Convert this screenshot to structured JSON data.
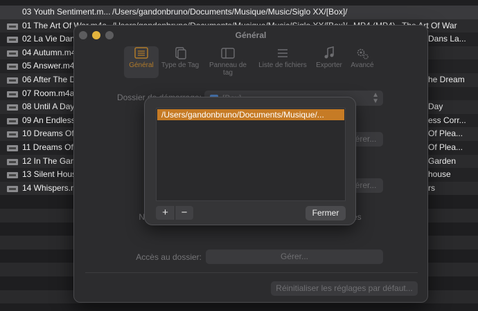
{
  "file_list": {
    "rows": [
      {
        "name": "03 Youth Sentiment.m...",
        "path": "/Users/gandonbruno/Documents/Musique/Music/Siglo XX/[Box]/",
        "format": "",
        "right": ""
      },
      {
        "name": "01 The Art Of War.m4a",
        "path": "/Users/gandonbruno/Documents/Musique/Music/Siglo XX/[Box]/",
        "format": "MP4 (MP4)",
        "right": "The Art Of War"
      },
      {
        "name": "02 La Vie Dan",
        "path": "",
        "format": "",
        "right": "Dans La..."
      },
      {
        "name": "04 Autumn.m4",
        "path": "",
        "format": "",
        "right": ""
      },
      {
        "name": "05 Answer.m4",
        "path": "",
        "format": "",
        "right": ""
      },
      {
        "name": "06 After The D",
        "path": "",
        "format": "",
        "right": "he Dream"
      },
      {
        "name": "07 Room.m4a",
        "path": "",
        "format": "",
        "right": ""
      },
      {
        "name": "08 Until A Day",
        "path": "",
        "format": "",
        "right": "Day"
      },
      {
        "name": "09 An Endless",
        "path": "",
        "format": "",
        "right": "ess Corr..."
      },
      {
        "name": "10 Dreams Of",
        "path": "",
        "format": "",
        "right": "Of Plea..."
      },
      {
        "name": "11 Dreams Of",
        "path": "",
        "format": "",
        "right": "Of Plea..."
      },
      {
        "name": "12 In The Gard",
        "path": "",
        "format": "",
        "right": "Garden"
      },
      {
        "name": "13 Silent House",
        "path": "",
        "format": "",
        "right": "house"
      },
      {
        "name": "14 Whispers.m",
        "path": "",
        "format": "",
        "right": "rs"
      }
    ]
  },
  "settings_window": {
    "title": "Général",
    "toolbar": [
      {
        "label": "Général",
        "icon": "general-icon",
        "active": true
      },
      {
        "label": "Type de Tag",
        "icon": "tag-type-icon",
        "active": false
      },
      {
        "label": "Panneau de tag",
        "icon": "tag-panel-icon",
        "active": false
      },
      {
        "label": "Liste de fichiers",
        "icon": "file-list-icon",
        "active": false
      },
      {
        "label": "Exporter",
        "icon": "export-icon",
        "active": false
      },
      {
        "label": "Avancé",
        "icon": "advanced-icon",
        "active": false
      }
    ],
    "start_folder_label": "Dossier de démarrage:",
    "start_folder_value": "[Box]",
    "button_partial_1": "érer...",
    "button_partial_2": "érer...",
    "partial_label_left": "N",
    "partial_label_right": "es",
    "folder_access_label": "Accès au dossier:",
    "manage_label": "Gérer...",
    "reset_label": "Réinitialiser les réglages par défaut..."
  },
  "sheet": {
    "folders": [
      "/Users/gandonbruno/Documents/Musique/..."
    ],
    "add_label": "+",
    "remove_label": "−",
    "close_label": "Fermer"
  }
}
